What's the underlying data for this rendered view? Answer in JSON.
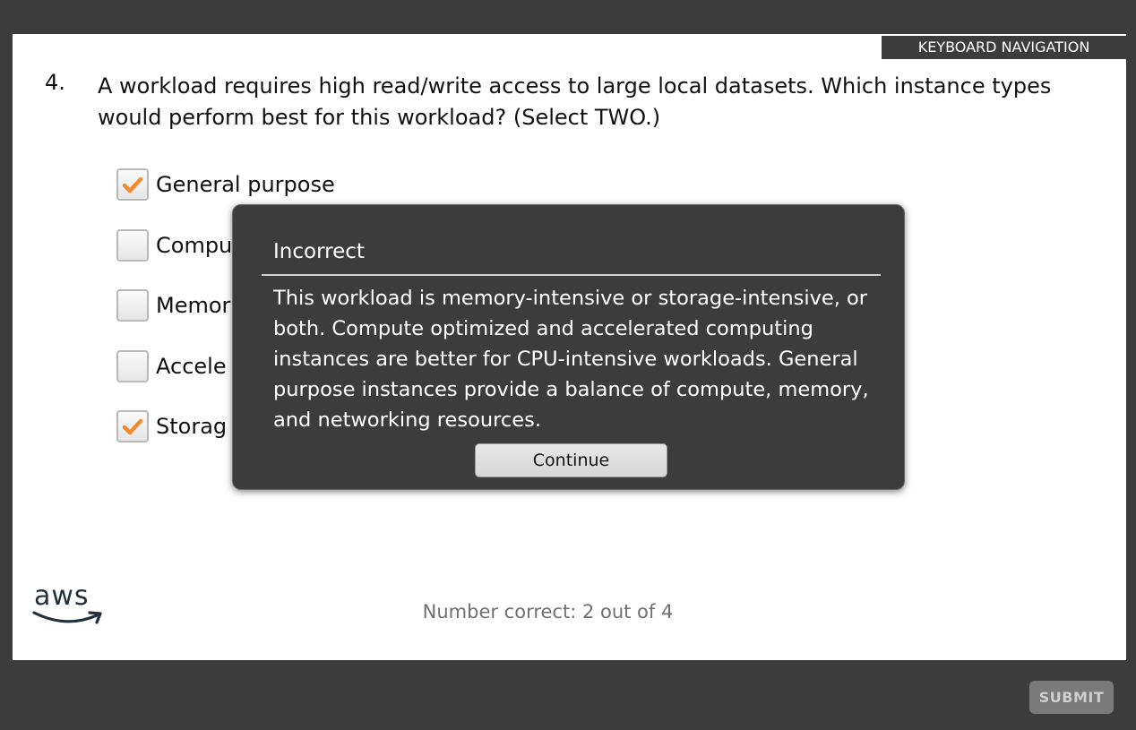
{
  "header": {
    "keyboard_navigation": "KEYBOARD NAVIGATION"
  },
  "question": {
    "number": "4.",
    "text": "A workload requires high read/write access to large local datasets. Which instance types would perform best for this workload? (Select TWO.)"
  },
  "options": [
    {
      "label": "General purpose",
      "checked": true
    },
    {
      "label": "Compu",
      "checked": false
    },
    {
      "label": "Memor",
      "checked": false
    },
    {
      "label": "Accele",
      "checked": false
    },
    {
      "label": "Storag",
      "checked": true
    }
  ],
  "logo": {
    "text": "aws"
  },
  "score": "Number correct: 2 out of 4",
  "submit_label": "SUBMIT",
  "feedback": {
    "title": "Incorrect",
    "body": "This workload is memory-intensive or storage-intensive, or both. Compute optimized and accelerated computing instances are better for CPU-intensive workloads. General purpose instances provide a balance of compute, memory, and networking resources.",
    "continue_label": "Continue"
  },
  "colors": {
    "check": "#f08c2e",
    "frame": "#3c3c3c",
    "text_muted": "#707070"
  }
}
